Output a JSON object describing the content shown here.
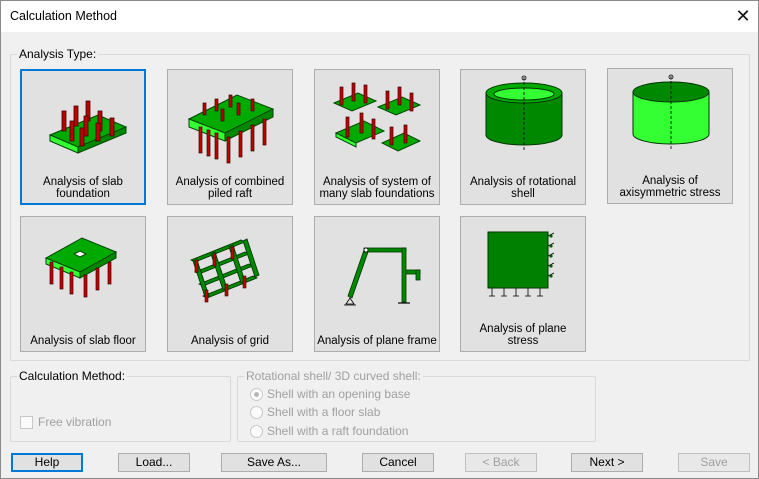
{
  "window": {
    "title": "Calculation Method"
  },
  "analysis_type": {
    "label": "Analysis Type:",
    "cards": [
      {
        "label": "Analysis of slab foundation",
        "icon": "slab-foundation-icon",
        "selected": true
      },
      {
        "label": "Analysis of combined piled raft",
        "icon": "piled-raft-icon"
      },
      {
        "label": "Analysis of system of many slab foundations",
        "icon": "multi-slab-icon"
      },
      {
        "label": "Analysis of rotational shell",
        "icon": "rotational-shell-icon"
      },
      {
        "label": "Analysis of axisymmetric stress",
        "icon": "axisymmetric-icon"
      },
      {
        "label": "Analysis of slab floor",
        "icon": "slab-floor-icon"
      },
      {
        "label": "Analysis of grid",
        "icon": "grid-icon"
      },
      {
        "label": "Analysis of plane frame",
        "icon": "plane-frame-icon"
      },
      {
        "label": "Analysis of plane stress",
        "icon": "plane-stress-icon"
      }
    ]
  },
  "calculation_method": {
    "label": "Calculation Method:",
    "free_vibration": "Free vibration"
  },
  "rotational_shell": {
    "label": "Rotational shell/ 3D curved shell:",
    "options": [
      "Shell with an opening base",
      "Shell with a floor slab",
      "Shell with a raft foundation"
    ]
  },
  "buttons": {
    "help": "Help",
    "load": "Load...",
    "save_as": "Save As...",
    "cancel": "Cancel",
    "back": "< Back",
    "next": "Next >",
    "save": "Save"
  },
  "colors": {
    "green": "#008000",
    "light_green": "#33ff33",
    "pile_red": "#c00000",
    "accent": "#0078d7"
  }
}
